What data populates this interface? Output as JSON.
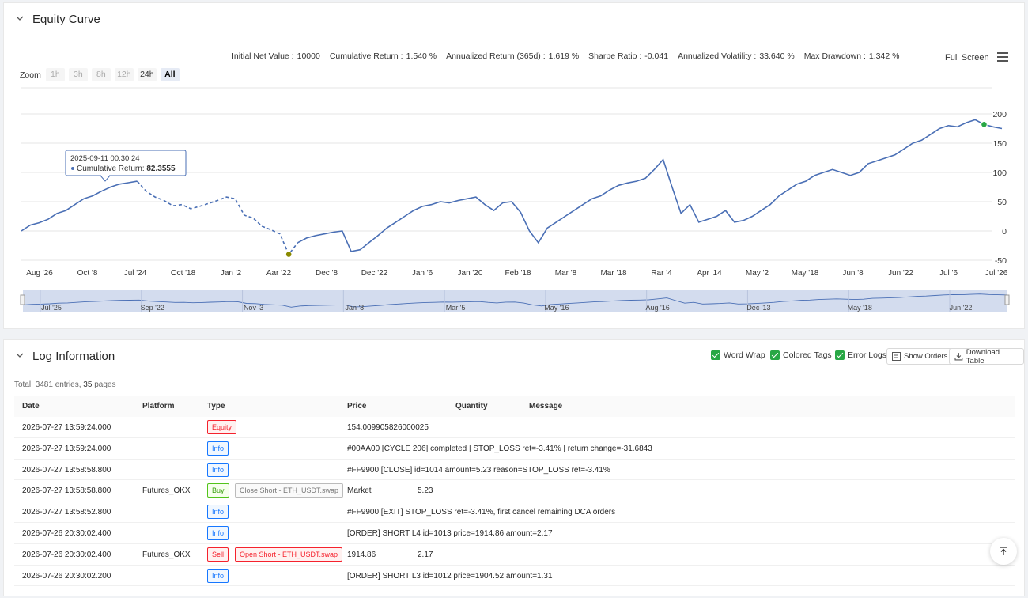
{
  "equity": {
    "title": "Equity Curve",
    "stats": [
      {
        "label": "Initial Net Value :",
        "value": "10000"
      },
      {
        "label": "Cumulative Return :",
        "value": "1.540 %"
      },
      {
        "label": "Annualized Return (365d) :",
        "value": "1.619 %"
      },
      {
        "label": "Sharpe Ratio :",
        "value": "-0.041"
      },
      {
        "label": "Annualized Volatility :",
        "value": "33.640 %"
      },
      {
        "label": "Max Drawdown :",
        "value": "1.342 %"
      }
    ],
    "full_screen": "Full Screen",
    "zoom_label": "Zoom",
    "zoom_options": [
      "1h",
      "3h",
      "8h",
      "12h",
      "24h",
      "All"
    ],
    "zoom_selected": "All",
    "tooltip": {
      "date": "2025-09-11 00:30:24",
      "label": "Cumulative Return:",
      "value": "82.3555"
    }
  },
  "chart_data": {
    "type": "line",
    "x_ticks": [
      "Aug '26",
      "Oct '8",
      "Jul '24",
      "Oct '18",
      "Jan '2",
      "Aar '22",
      "Dec '8",
      "Dec '22",
      "Jan '6",
      "Jan '20",
      "Feb '18",
      "Mar '8",
      "Mar '18",
      "Rar '4",
      "Apr '14",
      "May '2",
      "May '18",
      "Jun '8",
      "Jun '22",
      "Jul '6",
      "Jul '26"
    ],
    "y_ticks": [
      200,
      150,
      100,
      50,
      0,
      -50
    ],
    "ylim": [
      -50,
      200
    ],
    "grid": true,
    "series": [
      {
        "values": [
          0,
          10,
          14,
          20,
          30,
          35,
          45,
          55,
          60,
          68,
          75,
          80,
          82.4,
          85,
          68,
          58,
          52,
          43,
          45,
          38,
          42,
          47,
          52,
          58,
          55,
          27,
          22,
          8,
          2,
          -5,
          -40,
          -20,
          -12,
          -8,
          -5,
          -2,
          0,
          -35,
          -32,
          -20,
          -8,
          5,
          15,
          25,
          35,
          42,
          45,
          50,
          48,
          52,
          55,
          58,
          45,
          35,
          48,
          50,
          32,
          0,
          -20,
          5,
          15,
          25,
          35,
          45,
          55,
          60,
          70,
          78,
          82,
          85,
          90,
          105,
          122,
          75,
          30,
          45,
          15,
          20,
          25,
          35,
          15,
          18,
          25,
          35,
          45,
          60,
          70,
          80,
          85,
          95,
          100,
          105,
          100,
          95,
          100,
          115,
          120,
          125,
          130,
          140,
          150,
          155,
          165,
          175,
          180,
          178,
          185,
          190,
          182,
          178,
          175
        ],
        "dashed_range": [
          13,
          31
        ]
      }
    ],
    "markers": [
      {
        "index": 30,
        "color": "#8a8a00"
      },
      {
        "index": 108,
        "color": "#28a745"
      }
    ],
    "navigator_ticks": [
      "Jul '25",
      "Sep '22",
      "Nov '3",
      "Jan '8",
      "Mar '5",
      "May '16",
      "Aug '16",
      "Dec '13",
      "May '18",
      "Jun '22"
    ]
  },
  "log": {
    "title": "Log Information",
    "toggles": [
      "Word Wrap",
      "Colored Tags",
      "Error Logs"
    ],
    "show_orders": "Show Orders",
    "download": "Download Table",
    "total_prefix": "Total:",
    "total_entries": "3481",
    "entries_word": "entries,",
    "total_pages": "35",
    "pages_word": "pages",
    "columns": [
      "Date",
      "Platform",
      "Type",
      "Price",
      "Quantity",
      "Message"
    ],
    "rows": [
      {
        "date": "2026-07-27 13:59:24.000",
        "platform": "",
        "type": "Equity",
        "type_color": "red",
        "extra": "",
        "extra_color": "",
        "price": "154.009905826000025",
        "quantity": "",
        "message": ""
      },
      {
        "date": "2026-07-27 13:59:24.000",
        "platform": "",
        "type": "Info",
        "type_color": "blue",
        "extra": "",
        "extra_color": "",
        "price": "#00AA00 [CYCLE 206] completed | STOP_LOSS ret=-3.41% | return change=-31.6843",
        "quantity": "",
        "message": ""
      },
      {
        "date": "2026-07-27 13:58:58.800",
        "platform": "",
        "type": "Info",
        "type_color": "blue",
        "extra": "",
        "extra_color": "",
        "price": "#FF9900 [CLOSE] id=1014 amount=5.23 reason=STOP_LOSS ret=-3.41%",
        "quantity": "",
        "message": ""
      },
      {
        "date": "2026-07-27 13:58:58.800",
        "platform": "Futures_OKX",
        "type": "Buy",
        "type_color": "green",
        "extra": "Close Short - ETH_USDT.swap",
        "extra_color": "grey",
        "price": "Market",
        "quantity": "5.23",
        "message": ""
      },
      {
        "date": "2026-07-27 13:58:52.800",
        "platform": "",
        "type": "Info",
        "type_color": "blue",
        "extra": "",
        "extra_color": "",
        "price": "#FF9900 [EXIT] STOP_LOSS ret=-3.41%, first cancel remaining DCA orders",
        "quantity": "",
        "message": ""
      },
      {
        "date": "2026-07-26 20:30:02.400",
        "platform": "",
        "type": "Info",
        "type_color": "blue",
        "extra": "",
        "extra_color": "",
        "price": "[ORDER] SHORT L4 id=1013 price=1914.86 amount=2.17",
        "quantity": "",
        "message": ""
      },
      {
        "date": "2026-07-26 20:30:02.400",
        "platform": "Futures_OKX",
        "type": "Sell",
        "type_color": "red",
        "extra": "Open Short - ETH_USDT.swap",
        "extra_color": "red",
        "price": "1914.86",
        "quantity": "2.17",
        "message": ""
      },
      {
        "date": "2026-07-26 20:30:02.200",
        "platform": "",
        "type": "Info",
        "type_color": "blue",
        "extra": "",
        "extra_color": "",
        "price": "[ORDER] SHORT L3 id=1012 price=1904.52 amount=1.31",
        "quantity": "",
        "message": ""
      }
    ]
  },
  "colors": {
    "line": "#4a6fb5",
    "navigator_bg": "#d3dcee",
    "accent_green": "#28a745"
  }
}
